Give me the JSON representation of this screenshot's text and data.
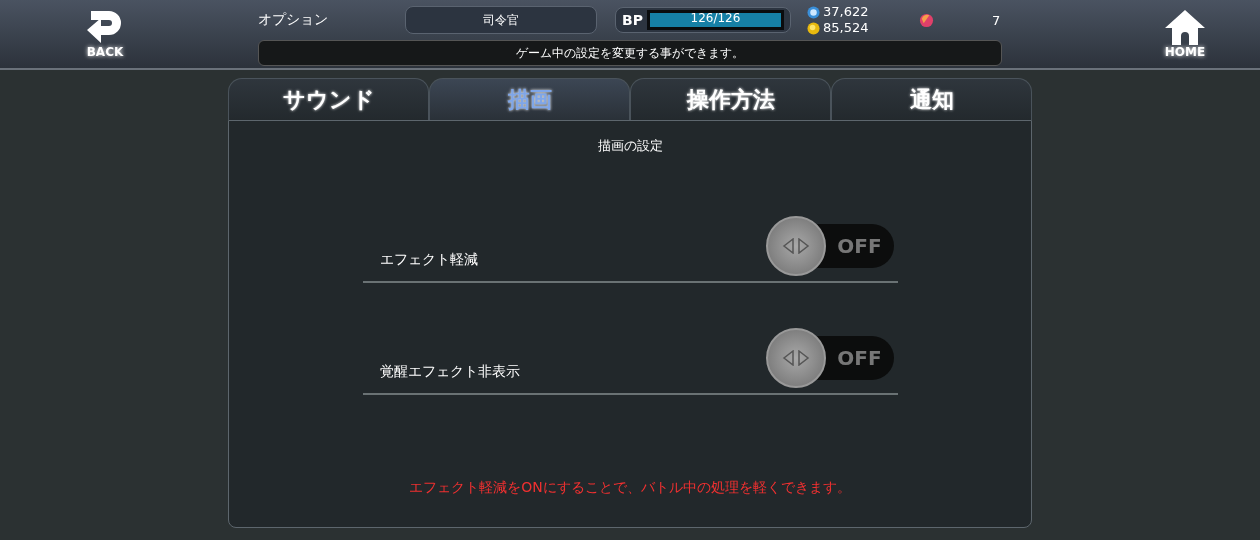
{
  "header": {
    "back_label": "BACK",
    "title": "オプション",
    "commander": "司令官",
    "bp_label": "BP",
    "bp": {
      "text": "126/126",
      "level": 1
    },
    "crystals": "37,622",
    "coins": "85,524",
    "gems": "7",
    "home_label": "HOME"
  },
  "message": "ゲーム中の設定を変更する事ができます。",
  "tabs": [
    {
      "label": "サウンド",
      "selected": false
    },
    {
      "label": "描画",
      "selected": true
    },
    {
      "label": "操作方法",
      "selected": false
    },
    {
      "label": "通知",
      "selected": false
    }
  ],
  "panel": {
    "title": "描画の設定",
    "settings": [
      {
        "label": "エフェクト軽減",
        "on": false,
        "state_text": "OFF"
      },
      {
        "label": "覚醒エフェクト非表示",
        "on": false,
        "state_text": "OFF"
      }
    ],
    "note": "エフェクト軽減をONにすることで、バトル中の処理を軽くできます。"
  }
}
